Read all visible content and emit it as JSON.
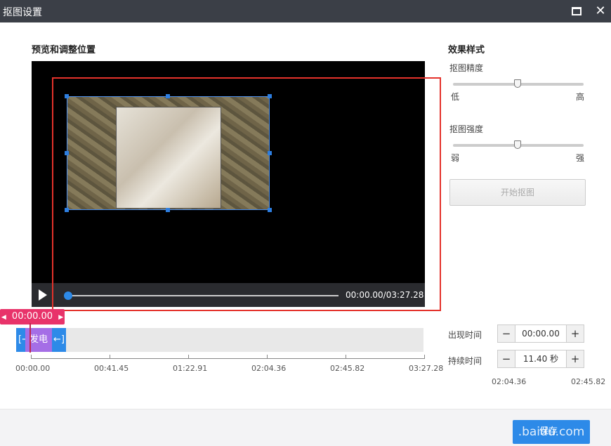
{
  "window": {
    "title": "抠图设置"
  },
  "preview": {
    "title": "预览和调整位置",
    "time": "00:00.00/03:27.28",
    "progress": 0
  },
  "effects": {
    "title": "效果样式",
    "precision": {
      "label": "抠图精度",
      "min": "低",
      "max": "高",
      "value": 50
    },
    "strength": {
      "label": "抠图强度",
      "min": "弱",
      "max": "强",
      "value": 50
    },
    "start_button": "开始抠图"
  },
  "timeline": {
    "cursor": "00:00.00",
    "clip_label": "发电",
    "ticks": [
      "00:00.00",
      "00:41.45",
      "01:22.91",
      "02:04.36",
      "02:45.82",
      "03:27.28"
    ]
  },
  "timing": {
    "appear_label": "出现时间",
    "appear_value": "00:00.00",
    "duration_label": "持续时间",
    "duration_value": "11.40 秒",
    "extra_ticks": [
      "02:04.36",
      "02:45.82"
    ]
  },
  "footer": {
    "save": "保存",
    "watermark": ".baidu.com"
  },
  "colors": {
    "accent": "#2d8ae8",
    "cursor": "#e8336a",
    "clip": "#a56ee6",
    "redbox": "#e4322b"
  }
}
